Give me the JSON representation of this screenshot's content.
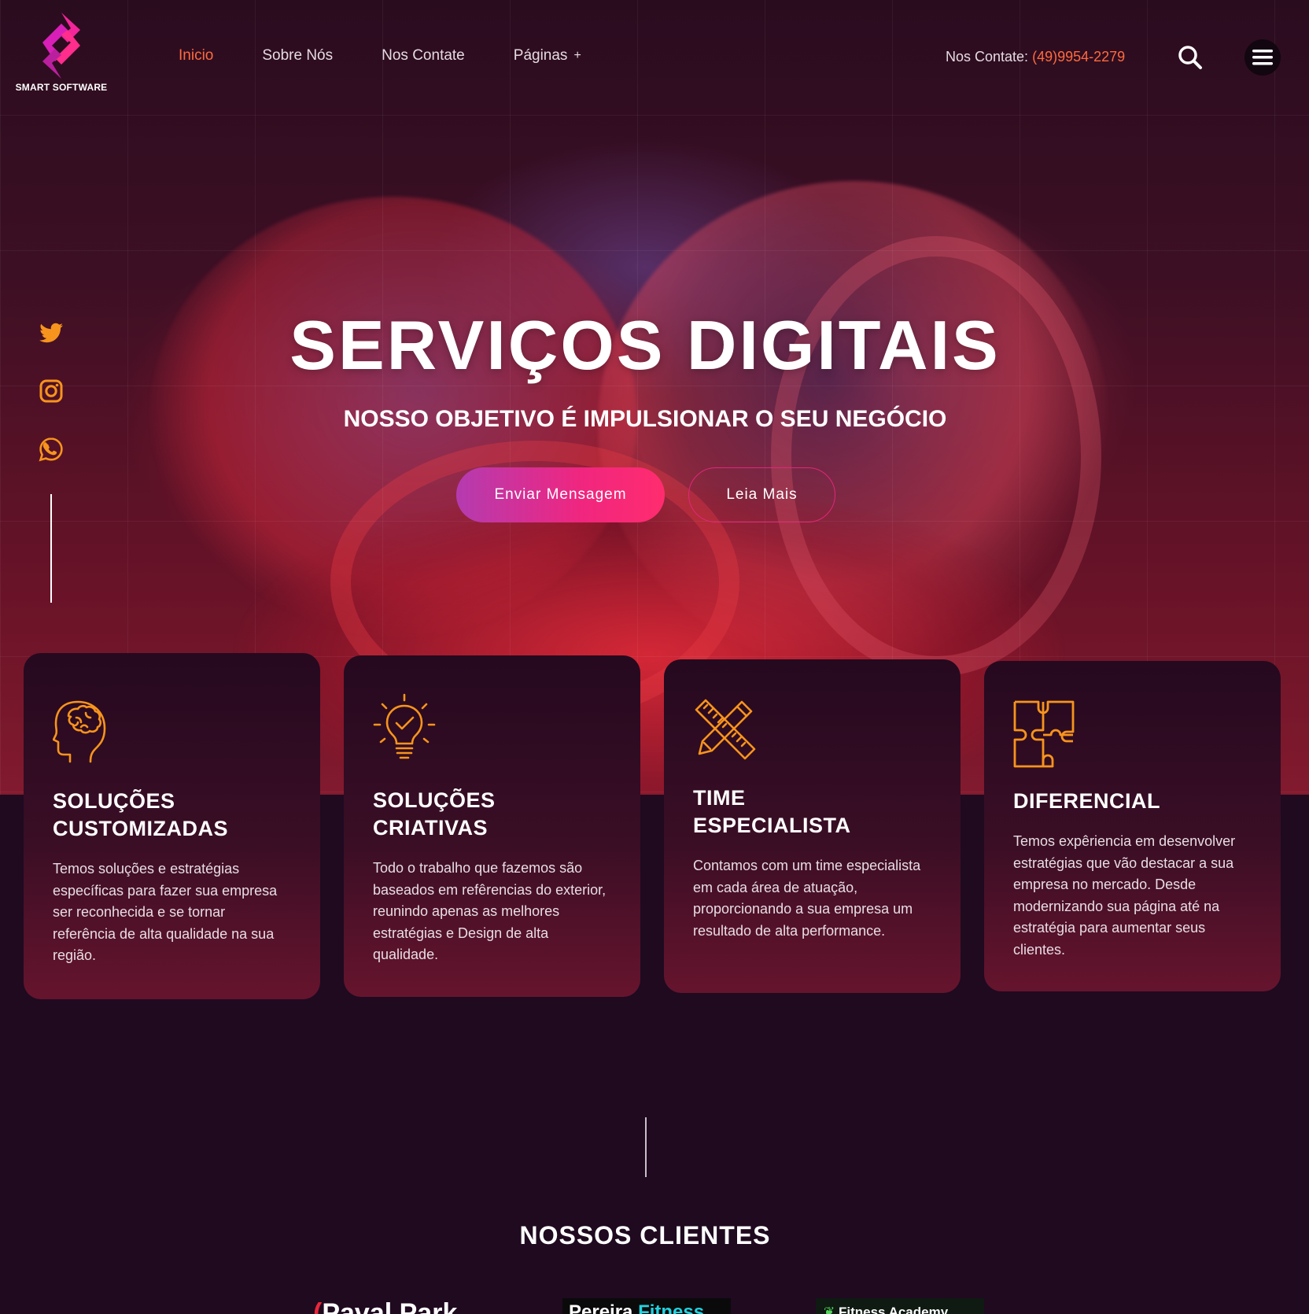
{
  "brand": {
    "name": "SMART SOFTWARE"
  },
  "nav": {
    "items": [
      {
        "label": "Inicio",
        "active": true
      },
      {
        "label": "Sobre Nós",
        "active": false
      },
      {
        "label": "Nos Contate",
        "active": false
      },
      {
        "label": "Páginas",
        "active": false,
        "submenu": "+"
      }
    ]
  },
  "contact": {
    "label": "Nos Contate:",
    "phone": "(49)9954-2279"
  },
  "social": [
    "twitter-icon",
    "instagram-icon",
    "whatsapp-icon"
  ],
  "hero": {
    "title": "SERVIÇOS DIGITAIS",
    "subtitle": "NOSSO OBJETIVO É IMPULSIONAR O SEU NEGÓCIO",
    "primary_button": "Enviar Mensagem",
    "secondary_button": "Leia Mais"
  },
  "cards": [
    {
      "icon": "brain-head-icon",
      "title": "SOLUÇÕES\nCUSTOMIZADAS",
      "text": "Temos soluções e estratégias específicas para fazer sua empresa ser reconhecida e se tornar referência de alta qualidade na sua região."
    },
    {
      "icon": "lightbulb-check-icon",
      "title": "SOLUÇÕES\nCRIATIVAS",
      "text": "Todo o trabalho que fazemos são baseados em refêrencias do exterior, reunindo apenas as melhores estratégias e Design de alta qualidade."
    },
    {
      "icon": "pencil-ruler-icon",
      "title": "TIME\nESPECIALISTA",
      "text": "Contamos com um time especialista em cada área de atuação, proporcionando a sua empresa um resultado de alta performance."
    },
    {
      "icon": "puzzle-icon",
      "title": "DIFERENCIAL",
      "text": "Temos expêriencia em desenvolver estratégias que vão destacar a sua empresa no mercado. Desde modernizando sua página até na estratégia para aumentar seus clientes."
    }
  ],
  "clients": {
    "title": "NOSSOS CLIENTES",
    "logos": [
      {
        "name_a": "Paval Park"
      },
      {
        "name_a": "Pereira ",
        "name_b": "Fitness"
      },
      {
        "name_a": "Fitness Academy"
      }
    ]
  },
  "colors": {
    "accent": "#ff6a3d",
    "pink": "#f0267f",
    "background": "#1f0a20",
    "icon_orange": "#f7941d"
  }
}
